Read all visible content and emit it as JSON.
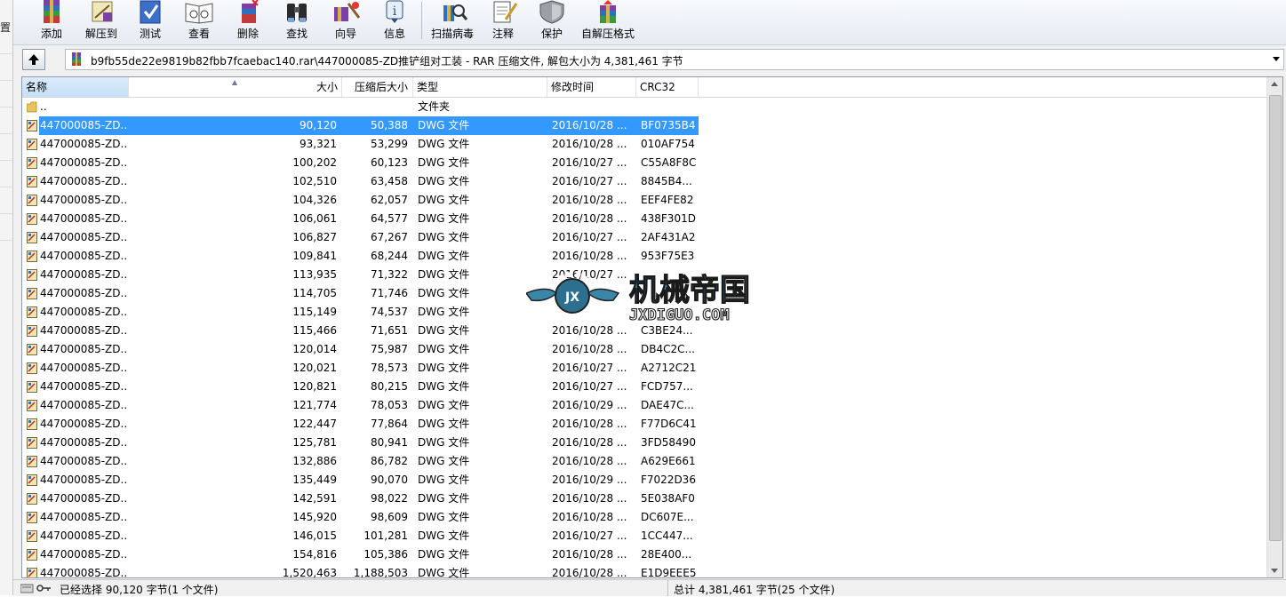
{
  "left_edge_char": "置",
  "toolbar": {
    "buttons": [
      {
        "id": "add",
        "label": "添加",
        "icon": "add-archive-icon"
      },
      {
        "id": "extract",
        "label": "解压到",
        "icon": "extract-to-icon"
      },
      {
        "id": "test",
        "label": "测试",
        "icon": "test-icon"
      },
      {
        "id": "view",
        "label": "查看",
        "icon": "view-icon"
      },
      {
        "id": "delete",
        "label": "删除",
        "icon": "delete-icon"
      },
      {
        "id": "find",
        "label": "查找",
        "icon": "binoculars-icon"
      },
      {
        "id": "wizard",
        "label": "向导",
        "icon": "wizard-icon"
      },
      {
        "id": "info",
        "label": "信息",
        "icon": "info-icon"
      },
      {
        "id": "virus",
        "label": "扫描病毒",
        "icon": "virus-scan-icon"
      },
      {
        "id": "comment",
        "label": "注释",
        "icon": "comment-icon"
      },
      {
        "id": "protect",
        "label": "保护",
        "icon": "shield-icon"
      },
      {
        "id": "sfx",
        "label": "自解压格式",
        "icon": "sfx-icon"
      }
    ]
  },
  "address": {
    "path": "b9fb55de22e9819b82fbb7fcaebac140.rar\\447000085-ZD推铲组对工装 - RAR 压缩文件, 解包大小为 4,381,461 字节"
  },
  "columns": {
    "name": "名称",
    "size": "大小",
    "compressed": "压缩后大小",
    "type": "类型",
    "modified": "修改时间",
    "crc": "CRC32"
  },
  "parent_row": {
    "name": "..",
    "type": "文件夹"
  },
  "files": [
    {
      "name": "447000085-ZD...",
      "size": "90,120",
      "compressed": "50,388",
      "type": "DWG 文件",
      "modified": "2016/10/28 ...",
      "crc": "BF0735B4",
      "selected": true
    },
    {
      "name": "447000085-ZD...",
      "size": "93,321",
      "compressed": "53,299",
      "type": "DWG 文件",
      "modified": "2016/10/28 ...",
      "crc": "010AF754"
    },
    {
      "name": "447000085-ZD...",
      "size": "100,202",
      "compressed": "60,123",
      "type": "DWG 文件",
      "modified": "2016/10/27 ...",
      "crc": "C55A8F8C"
    },
    {
      "name": "447000085-ZD...",
      "size": "102,510",
      "compressed": "63,458",
      "type": "DWG 文件",
      "modified": "2016/10/27 ...",
      "crc": "8845B4..."
    },
    {
      "name": "447000085-ZD...",
      "size": "104,326",
      "compressed": "62,057",
      "type": "DWG 文件",
      "modified": "2016/10/28 ...",
      "crc": "EEF4FE82"
    },
    {
      "name": "447000085-ZD...",
      "size": "106,061",
      "compressed": "64,577",
      "type": "DWG 文件",
      "modified": "2016/10/28 ...",
      "crc": "438F301D"
    },
    {
      "name": "447000085-ZD...",
      "size": "106,827",
      "compressed": "67,267",
      "type": "DWG 文件",
      "modified": "2016/10/27 ...",
      "crc": "2AF431A2"
    },
    {
      "name": "447000085-ZD...",
      "size": "109,841",
      "compressed": "68,244",
      "type": "DWG 文件",
      "modified": "2016/10/28 ...",
      "crc": "953F75E3"
    },
    {
      "name": "447000085-ZD...",
      "size": "113,935",
      "compressed": "71,322",
      "type": "DWG 文件",
      "modified": "2016/10/27 ...",
      "crc": ""
    },
    {
      "name": "447000085-ZD...",
      "size": "114,705",
      "compressed": "71,746",
      "type": "DWG 文件",
      "modified": "",
      "crc": ""
    },
    {
      "name": "447000085-ZD...",
      "size": "115,149",
      "compressed": "74,537",
      "type": "DWG 文件",
      "modified": "",
      "crc": ""
    },
    {
      "name": "447000085-ZD...",
      "size": "115,466",
      "compressed": "71,651",
      "type": "DWG 文件",
      "modified": "2016/10/28 ...",
      "crc": "C3BE24..."
    },
    {
      "name": "447000085-ZD...",
      "size": "120,014",
      "compressed": "75,987",
      "type": "DWG 文件",
      "modified": "2016/10/28 ...",
      "crc": "DB4C2C..."
    },
    {
      "name": "447000085-ZD...",
      "size": "120,021",
      "compressed": "78,573",
      "type": "DWG 文件",
      "modified": "2016/10/27 ...",
      "crc": "A2712C21"
    },
    {
      "name": "447000085-ZD...",
      "size": "120,821",
      "compressed": "80,215",
      "type": "DWG 文件",
      "modified": "2016/10/27 ...",
      "crc": "FCD757..."
    },
    {
      "name": "447000085-ZD...",
      "size": "121,774",
      "compressed": "78,053",
      "type": "DWG 文件",
      "modified": "2016/10/29 ...",
      "crc": "DAE47C..."
    },
    {
      "name": "447000085-ZD...",
      "size": "122,447",
      "compressed": "77,864",
      "type": "DWG 文件",
      "modified": "2016/10/28 ...",
      "crc": "F77D6C41"
    },
    {
      "name": "447000085-ZD...",
      "size": "125,781",
      "compressed": "80,941",
      "type": "DWG 文件",
      "modified": "2016/10/28 ...",
      "crc": "3FD58490"
    },
    {
      "name": "447000085-ZD...",
      "size": "132,886",
      "compressed": "86,782",
      "type": "DWG 文件",
      "modified": "2016/10/28 ...",
      "crc": "A629E661"
    },
    {
      "name": "447000085-ZD...",
      "size": "135,449",
      "compressed": "90,070",
      "type": "DWG 文件",
      "modified": "2016/10/29 ...",
      "crc": "F7022D36"
    },
    {
      "name": "447000085-ZD...",
      "size": "142,591",
      "compressed": "98,022",
      "type": "DWG 文件",
      "modified": "2016/10/28 ...",
      "crc": "5E038AF0"
    },
    {
      "name": "447000085-ZD...",
      "size": "145,920",
      "compressed": "98,609",
      "type": "DWG 文件",
      "modified": "2016/10/28 ...",
      "crc": "DC607E..."
    },
    {
      "name": "447000085-ZD...",
      "size": "146,015",
      "compressed": "101,281",
      "type": "DWG 文件",
      "modified": "2016/10/27 ...",
      "crc": "1CC447..."
    },
    {
      "name": "447000085-ZD...",
      "size": "154,816",
      "compressed": "105,386",
      "type": "DWG 文件",
      "modified": "2016/10/28 ...",
      "crc": "28E400..."
    },
    {
      "name": "447000085-ZD...",
      "size": "1,520,463",
      "compressed": "1,188,503",
      "type": "DWG 文件",
      "modified": "2016/10/28 ...",
      "crc": "E1D9EEE5"
    }
  ],
  "watermark": {
    "title": "机械帝国",
    "site": "JXDIGUO.COM",
    "emblem": "JX"
  },
  "status": {
    "selected": "已经选择 90,120 字节(1 个文件)",
    "total": "总计 4,381,461 字节(25 个文件)"
  },
  "colors": {
    "selection": "#3399ff",
    "toolbar_bg": "#e6ebf2"
  }
}
